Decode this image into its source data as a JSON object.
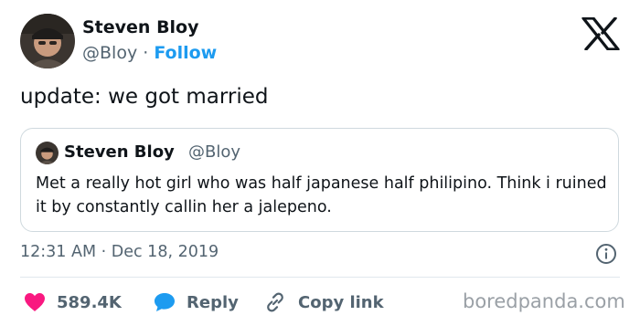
{
  "tweet": {
    "author_name": "Steven Bloy",
    "author_handle": "@Bloy",
    "separator": "·",
    "follow_label": "Follow",
    "text": "update: we got married",
    "timestamp": "12:31 AM · Dec 18, 2019"
  },
  "quoted_tweet": {
    "author_name": "Steven Bloy",
    "author_handle": "@Bloy",
    "text": "Met a really hot girl who was half japanese half philipino. Think i ruined it by constantly callin her a jalepeno."
  },
  "actions": {
    "like_count": "589.4K",
    "reply_label": "Reply",
    "copy_link_label": "Copy link"
  },
  "watermark": "boredpanda.com",
  "icons": {
    "brand": "x-logo-icon",
    "like": "heart-icon",
    "reply": "speech-bubble-icon",
    "copy": "link-icon",
    "info": "info-icon"
  },
  "colors": {
    "accent": "#1d9bf0",
    "like": "#f91880",
    "text": "#0f1419",
    "secondary": "#536471",
    "border": "#cfd9de"
  }
}
